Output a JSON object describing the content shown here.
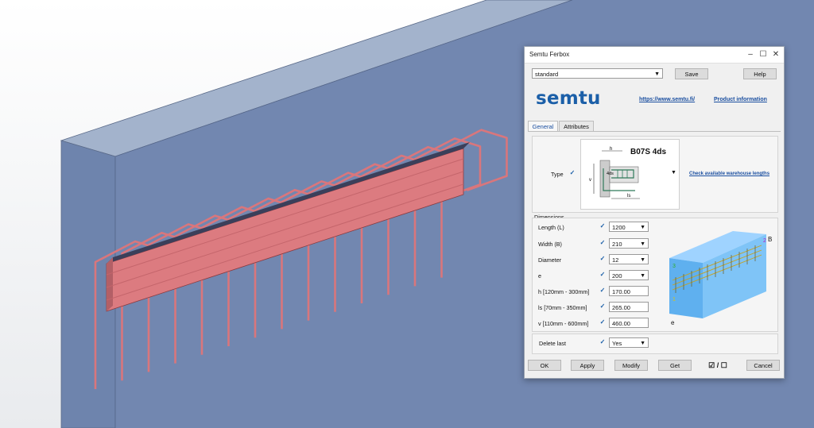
{
  "window": {
    "title": "Semtu Ferbox",
    "minimize_icon": "minimize-icon",
    "maximize_icon": "maximize-icon",
    "close_icon": "close-icon"
  },
  "toolbar": {
    "preset_value": "standard",
    "save_label": "Save",
    "help_label": "Help"
  },
  "branding": {
    "logo_text": "semtu",
    "website_link": "https://www.semtu.fi/",
    "product_info_link": "Product information"
  },
  "tabs": [
    {
      "label": "General",
      "active": true
    },
    {
      "label": "Attributes",
      "active": false
    }
  ],
  "type_section": {
    "label": "Type",
    "product_code": "B07S 4ds",
    "warehouse_link": "Check available warehouse lengths",
    "diagram_labels": {
      "h": "h",
      "ds": "4ds",
      "ls": "ls",
      "v": "v"
    }
  },
  "dimensions": {
    "group_label": "Dimensions",
    "rows": [
      {
        "label": "Length (L)",
        "value": "1200",
        "kind": "combo"
      },
      {
        "label": "Width (B)",
        "value": "210",
        "kind": "combo"
      },
      {
        "label": "Diameter",
        "value": "12",
        "kind": "combo"
      },
      {
        "label": "e",
        "value": "200",
        "kind": "combo"
      },
      {
        "label": "h [120mm - 300mm]",
        "value": "170.00",
        "kind": "text"
      },
      {
        "label": "ls [70mm - 350mm]",
        "value": "265.00",
        "kind": "text"
      },
      {
        "label": "v [110mm - 600mm]",
        "value": "460.00",
        "kind": "text"
      }
    ],
    "preview_labels": {
      "B": "B",
      "e": "e",
      "n2": "2",
      "n3": "3",
      "n1": "1"
    }
  },
  "delete_last": {
    "label": "Delete last",
    "value": "Yes"
  },
  "footer": {
    "ok_label": "OK",
    "apply_label": "Apply",
    "modify_label": "Modify",
    "get_label": "Get",
    "toggle_label": "☑ / ☐",
    "cancel_label": "Cancel"
  },
  "colors": {
    "wall": "#7186ad",
    "rebar": "#d9767c",
    "accent": "#1b5fa8"
  }
}
